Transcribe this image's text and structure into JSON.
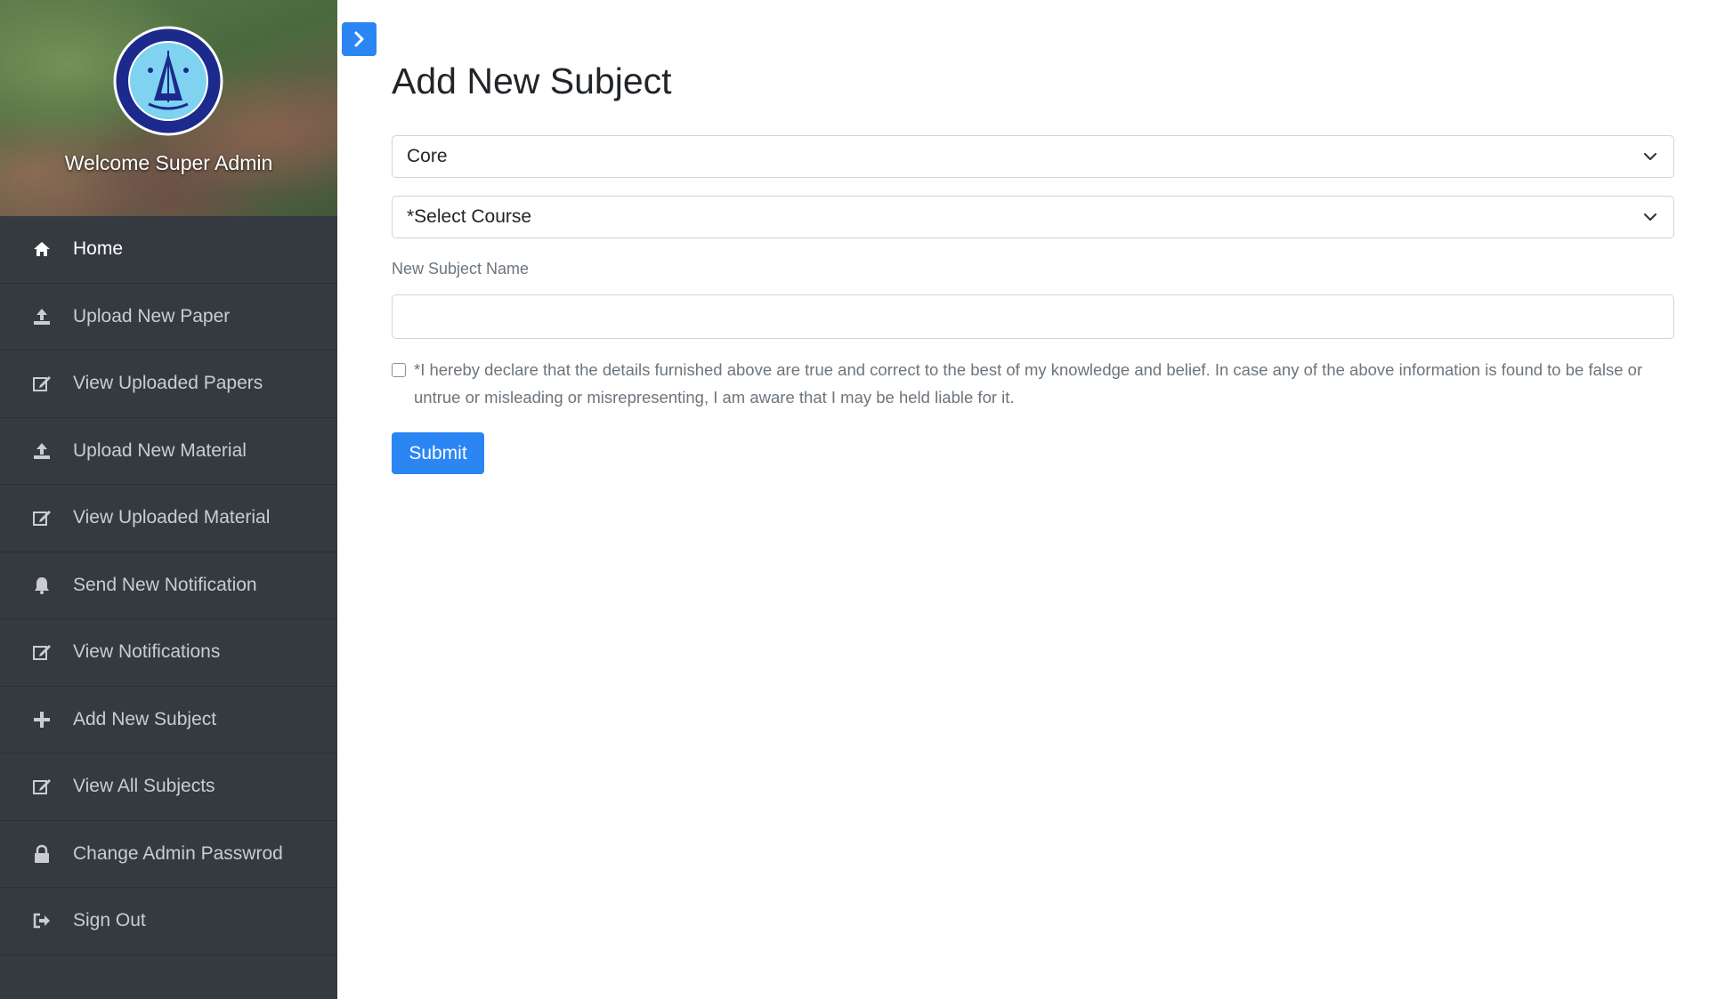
{
  "sidebar": {
    "welcome": "Welcome Super Admin",
    "logo_icon": "tezpur-university-seal",
    "items": [
      {
        "label": "Home",
        "icon": "home-icon"
      },
      {
        "label": "Upload New Paper",
        "icon": "upload-icon"
      },
      {
        "label": "View Uploaded Papers",
        "icon": "edit-icon"
      },
      {
        "label": "Upload New Material",
        "icon": "upload-icon"
      },
      {
        "label": "View Uploaded Material",
        "icon": "edit-icon"
      },
      {
        "label": "Send New Notification",
        "icon": "bell-icon"
      },
      {
        "label": "View Notifications",
        "icon": "edit-icon"
      },
      {
        "label": "Add New Subject",
        "icon": "plus-icon"
      },
      {
        "label": "View All Subjects",
        "icon": "edit-icon"
      },
      {
        "label": "Change Admin Passwrod",
        "icon": "lock-icon"
      },
      {
        "label": "Sign Out",
        "icon": "sign-out-icon"
      }
    ]
  },
  "main": {
    "title": "Add New Subject",
    "subject_type": {
      "selected": "Core"
    },
    "course": {
      "selected": "*Select Course"
    },
    "subject_name": {
      "label": "New Subject Name",
      "value": ""
    },
    "declaration": "*I hereby declare that the details furnished above are true and correct to the best of my knowledge and belief. In case any of the above information is found to be false or untrue or misleading or misrepresenting, I am aware that I may be held liable for it.",
    "submit_label": "Submit"
  },
  "colors": {
    "sidebar_bg": "#343a40",
    "accent": "#2b86f4",
    "text_dark": "#212529",
    "text_muted": "#6c757d"
  }
}
